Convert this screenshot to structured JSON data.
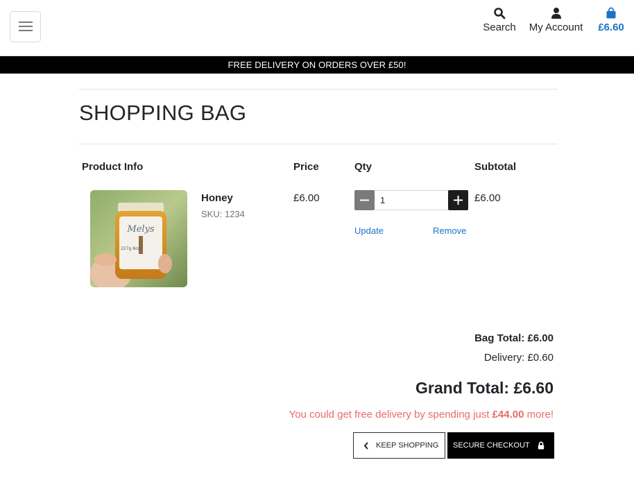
{
  "header": {
    "search_label": "Search",
    "account_label": "My Account",
    "bag_total": "£6.60"
  },
  "promo_banner": "FREE DELIVERY ON ORDERS OVER £50!",
  "page_title": "SHOPPING BAG",
  "table": {
    "columns": [
      "Product Info",
      "Price",
      "Qty",
      "Subtotal"
    ]
  },
  "items": [
    {
      "name": "Honey",
      "sku_label": "SKU:",
      "sku": "1234",
      "price": "£6.00",
      "quantity": "1",
      "subtotal": "£6.00",
      "update_label": "Update",
      "remove_label": "Remove",
      "image_label_text": "Melys",
      "image_weight_text": "227g 8oz"
    }
  ],
  "summary": {
    "bag_total_label": "Bag Total:",
    "bag_total_value": "£6.00",
    "delivery_label": "Delivery:",
    "delivery_value": "£0.60",
    "grand_total_label": "Grand Total:",
    "grand_total_value": "£6.60",
    "free_delivery_prefix": "You could get free delivery by spending just",
    "free_delivery_amount": "£44.00",
    "free_delivery_suffix": "more!"
  },
  "buttons": {
    "keep_shopping": "KEEP SHOPPING",
    "secure_checkout": "SECURE CHECKOUT"
  },
  "colors": {
    "accent": "#1a73c8",
    "promo_bg": "#000000",
    "warning_text": "#e86b6b"
  },
  "icons": [
    "menu-icon",
    "search-icon",
    "user-icon",
    "bag-icon",
    "minus-icon",
    "plus-icon",
    "chevron-left-icon",
    "lock-icon"
  ]
}
